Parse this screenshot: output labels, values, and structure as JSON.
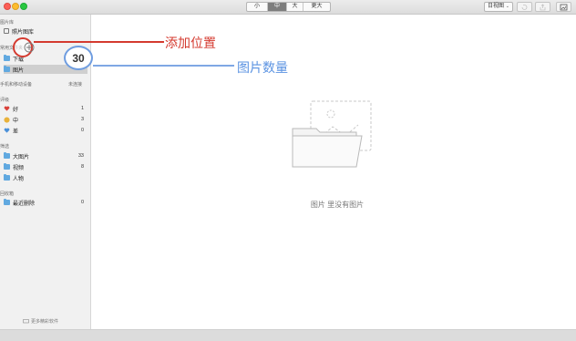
{
  "toolbar": {
    "size_tabs": [
      "小",
      "中",
      "大",
      "更大"
    ],
    "active_size": "中",
    "view_mode": "日视图"
  },
  "sidebar": {
    "sections": {
      "library": "图片库",
      "common_folders": "常用文件夹",
      "devices": "手机和移动设备",
      "rating": "评级",
      "filter": "筛选",
      "trash_section": "回收箱"
    },
    "library_item": "照片图库",
    "folders": [
      {
        "label": "下载"
      },
      {
        "label": "图片"
      }
    ],
    "device_status": "未连接",
    "ratings": [
      {
        "label": "好",
        "count": "1",
        "color": "#d9413a"
      },
      {
        "label": "中",
        "count": "3",
        "color": "#e9b23a"
      },
      {
        "label": "差",
        "count": "0",
        "color": "#4a90d9"
      }
    ],
    "filters": [
      {
        "label": "大图片",
        "count": "33"
      },
      {
        "label": "视频",
        "count": "8"
      },
      {
        "label": "人物",
        "count": ""
      }
    ],
    "trash": {
      "label": "最近删除",
      "count": "0"
    },
    "footer": "更多精彩软件"
  },
  "main": {
    "empty_message": "图片 里没有图片"
  },
  "annotations": {
    "add_location_label": "添加位置",
    "photo_count_label": "图片数量",
    "photo_count_value": "30",
    "colors": {
      "red": "#d43a2f",
      "blue": "#5b93e2"
    }
  }
}
